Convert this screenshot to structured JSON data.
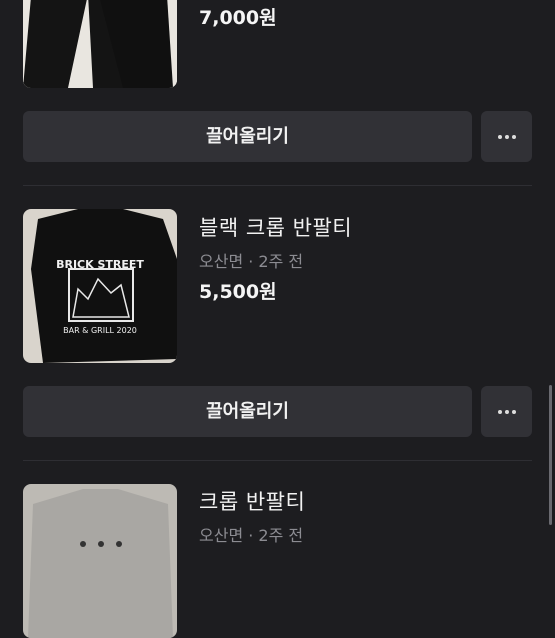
{
  "items": [
    {
      "title": "",
      "meta": "",
      "price": "7,000원",
      "bump_label": "끌어올리기",
      "thumb_icon": "black-pants-photo",
      "more_icon": "more-horizontal-icon"
    },
    {
      "title": "블랙 크롭 반팔티",
      "meta": "오산면 · 2주 전",
      "price": "5,500원",
      "bump_label": "끌어올리기",
      "thumb_icon": "black-tshirt-photo",
      "thumb_text_1": "BRICK STREET",
      "thumb_text_2": "BAR & GRILL 2020",
      "more_icon": "more-horizontal-icon"
    },
    {
      "title": "크롭 반팔티",
      "meta": "오산면 · 2주 전",
      "price": "",
      "thumb_icon": "gray-shirt-photo"
    }
  ],
  "colors": {
    "background": "#1d1d20",
    "button": "#313136",
    "meta_text": "#8c8c92",
    "divider": "#2e2e33"
  }
}
